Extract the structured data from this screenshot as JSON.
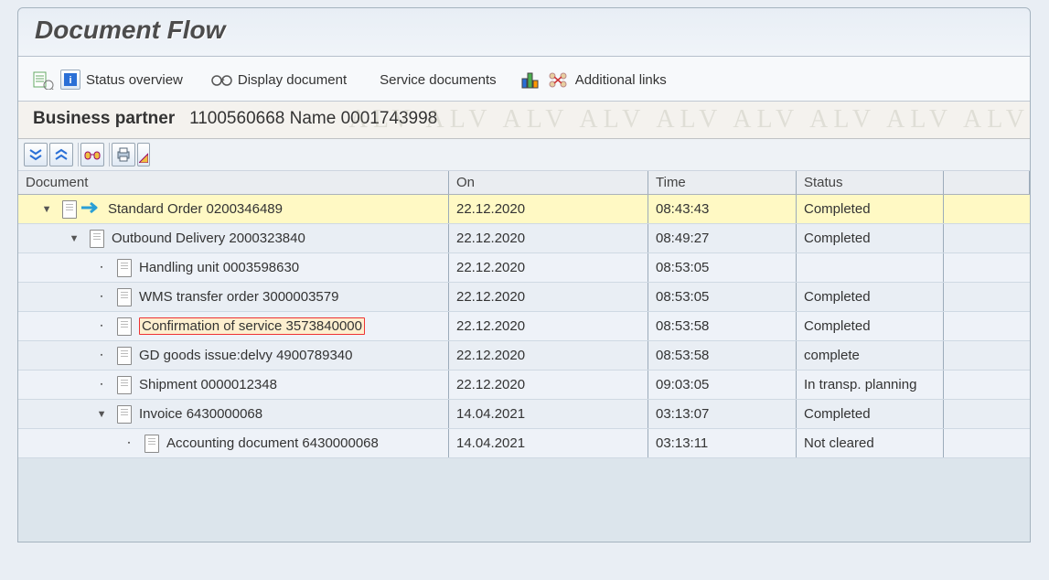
{
  "title": "Document Flow",
  "toolbar": {
    "status_overview": "Status overview",
    "display_document": "Display document",
    "service_documents": "Service documents",
    "additional_links": "Additional links"
  },
  "business_partner": {
    "label": "Business partner",
    "value": "1100560668 Name 0001743998"
  },
  "columns": {
    "document": "Document",
    "on": "On",
    "time": "Time",
    "status": "Status"
  },
  "rows": [
    {
      "depth": 0,
      "expand": "open",
      "selected": true,
      "icon": "arrow",
      "highlight": false,
      "label": "Standard Order 0200346489",
      "on": "22.12.2020",
      "time": "08:43:43",
      "status": "Completed"
    },
    {
      "depth": 1,
      "expand": "open",
      "selected": false,
      "icon": "doc",
      "highlight": false,
      "label": "Outbound Delivery 2000323840",
      "on": "22.12.2020",
      "time": "08:49:27",
      "status": "Completed"
    },
    {
      "depth": 2,
      "expand": "leaf",
      "selected": false,
      "icon": "doc",
      "highlight": false,
      "label": "Handling unit 0003598630",
      "on": "22.12.2020",
      "time": "08:53:05",
      "status": ""
    },
    {
      "depth": 2,
      "expand": "leaf",
      "selected": false,
      "icon": "doc",
      "highlight": false,
      "label": "WMS transfer order 3000003579",
      "on": "22.12.2020",
      "time": "08:53:05",
      "status": "Completed"
    },
    {
      "depth": 2,
      "expand": "leaf",
      "selected": false,
      "icon": "doc",
      "highlight": true,
      "label": "Confirmation of service 3573840000",
      "on": "22.12.2020",
      "time": "08:53:58",
      "status": "Completed"
    },
    {
      "depth": 2,
      "expand": "leaf",
      "selected": false,
      "icon": "doc",
      "highlight": false,
      "label": "GD goods issue:delvy 4900789340",
      "on": "22.12.2020",
      "time": "08:53:58",
      "status": "complete"
    },
    {
      "depth": 2,
      "expand": "leaf",
      "selected": false,
      "icon": "doc",
      "highlight": false,
      "label": "Shipment 0000012348",
      "on": "22.12.2020",
      "time": "09:03:05",
      "status": "In transp. planning"
    },
    {
      "depth": 2,
      "expand": "open",
      "selected": false,
      "icon": "doc",
      "highlight": false,
      "label": "Invoice 6430000068",
      "on": "14.04.2021",
      "time": "03:13:07",
      "status": "Completed"
    },
    {
      "depth": 3,
      "expand": "leaf",
      "selected": false,
      "icon": "doc",
      "highlight": false,
      "label": "Accounting document 6430000068",
      "on": "14.04.2021",
      "time": "03:13:11",
      "status": "Not cleared"
    }
  ]
}
